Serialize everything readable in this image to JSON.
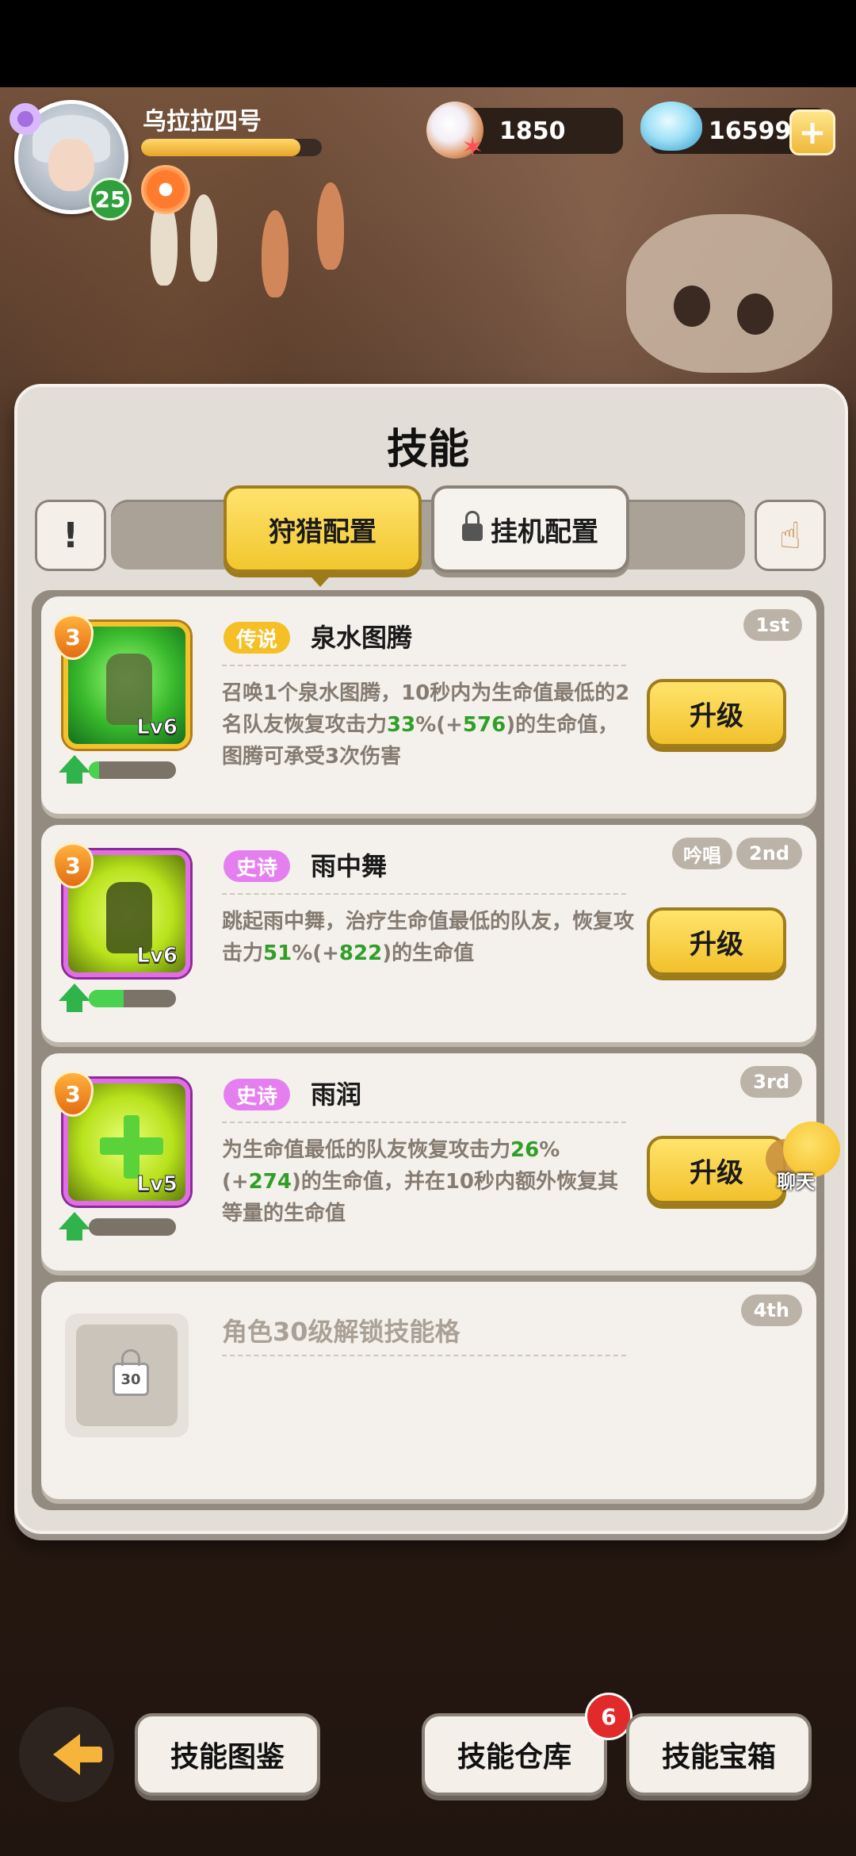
{
  "player": {
    "name": "乌拉拉四号",
    "level": "25",
    "xp_fraction": 0.88
  },
  "currency": {
    "pearls": "1850",
    "gems": "16599",
    "add_symbol": "+"
  },
  "panel": {
    "title": "技能",
    "info_symbol": "!",
    "tabs": [
      {
        "label": "狩猎配置",
        "active": true
      },
      {
        "label": "挂机配置",
        "active": false,
        "locked": true
      }
    ]
  },
  "skills": [
    {
      "rank": "1st",
      "rarity": "传说",
      "name": "泉水图腾",
      "desc_parts": [
        "召唤1个泉水图腾，10秒内为生命值最低的2名队友恢复攻击力",
        "33",
        "%(+",
        "576",
        ")的生命值，图腾可承受3次伤害"
      ],
      "level": "Lv6",
      "stars": "3",
      "progress_fraction": 0.12,
      "upgrade_label": "升级"
    },
    {
      "rank": "2nd",
      "tag": "吟唱",
      "rarity": "史诗",
      "name": "雨中舞",
      "desc_parts": [
        "跳起雨中舞，治疗生命值最低的队友，恢复攻击力",
        "51",
        "%(+",
        "822",
        ")的生命值"
      ],
      "level": "Lv6",
      "stars": "3",
      "progress_fraction": 0.4,
      "upgrade_label": "升级"
    },
    {
      "rank": "3rd",
      "rarity": "史诗",
      "name": "雨润",
      "desc_parts": [
        "为生命值最低的队友恢复攻击力",
        "26",
        "%(+",
        "274",
        ")的生命值，并在10秒内额外恢复其等量的生命值"
      ],
      "level": "Lv5",
      "stars": "3",
      "progress_fraction": 0.0,
      "upgrade_label": "升级"
    },
    {
      "rank": "4th",
      "locked_text": "角色30级解锁技能格",
      "lock_level": "30"
    }
  ],
  "chat": {
    "label": "聊天"
  },
  "bottom_nav": {
    "codex": "技能图鉴",
    "warehouse": "技能仓库",
    "warehouse_badge": "6",
    "chest": "技能宝箱"
  }
}
